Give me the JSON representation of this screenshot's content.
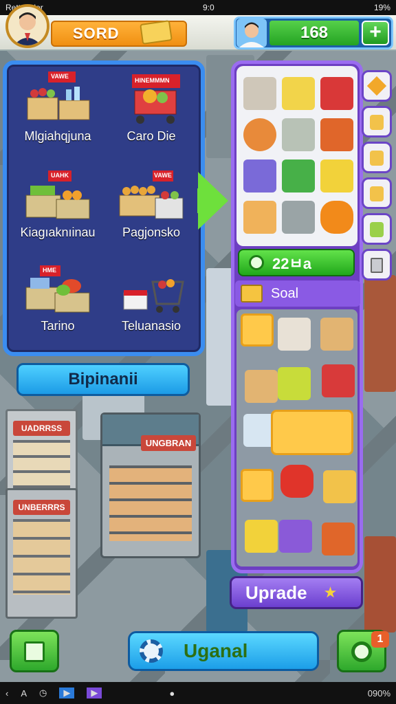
{
  "status_bar": {
    "carrier": "Rettekalor",
    "time": "9:0",
    "battery": "19%"
  },
  "player": {
    "name": "SORD",
    "avatar": "player-portrait"
  },
  "currency": {
    "amount": "168",
    "add_label": "+"
  },
  "categories": [
    {
      "label": "Mlgiahqjuna",
      "sign": "VAWE"
    },
    {
      "label": "Caro Die",
      "sign": "HINEMMMN"
    },
    {
      "label": "Kiagıaknıinau",
      "sign": "UAHK"
    },
    {
      "label": "Pagjonsko",
      "sign": "VAWE"
    },
    {
      "label": "Tarino",
      "sign": "HME"
    },
    {
      "label": "Teluanasio",
      "sign": ""
    }
  ],
  "left_action_label": "Bipinanii",
  "timer_label": "22ㅂa",
  "section_title": "Soal",
  "upgrade_label": "Uprade",
  "main_action_label": "Uganal",
  "notification_badge": "1",
  "store_signs": [
    "UADRRSS",
    "UNBERRRS",
    "UNGBRAN"
  ],
  "nav_bar": {
    "battery_text": "090%"
  },
  "colors": {
    "panel_blue": "#3b8df0",
    "panel_purple": "#6d3fc2",
    "accent_green": "#24a323",
    "accent_orange": "#f08f12"
  }
}
